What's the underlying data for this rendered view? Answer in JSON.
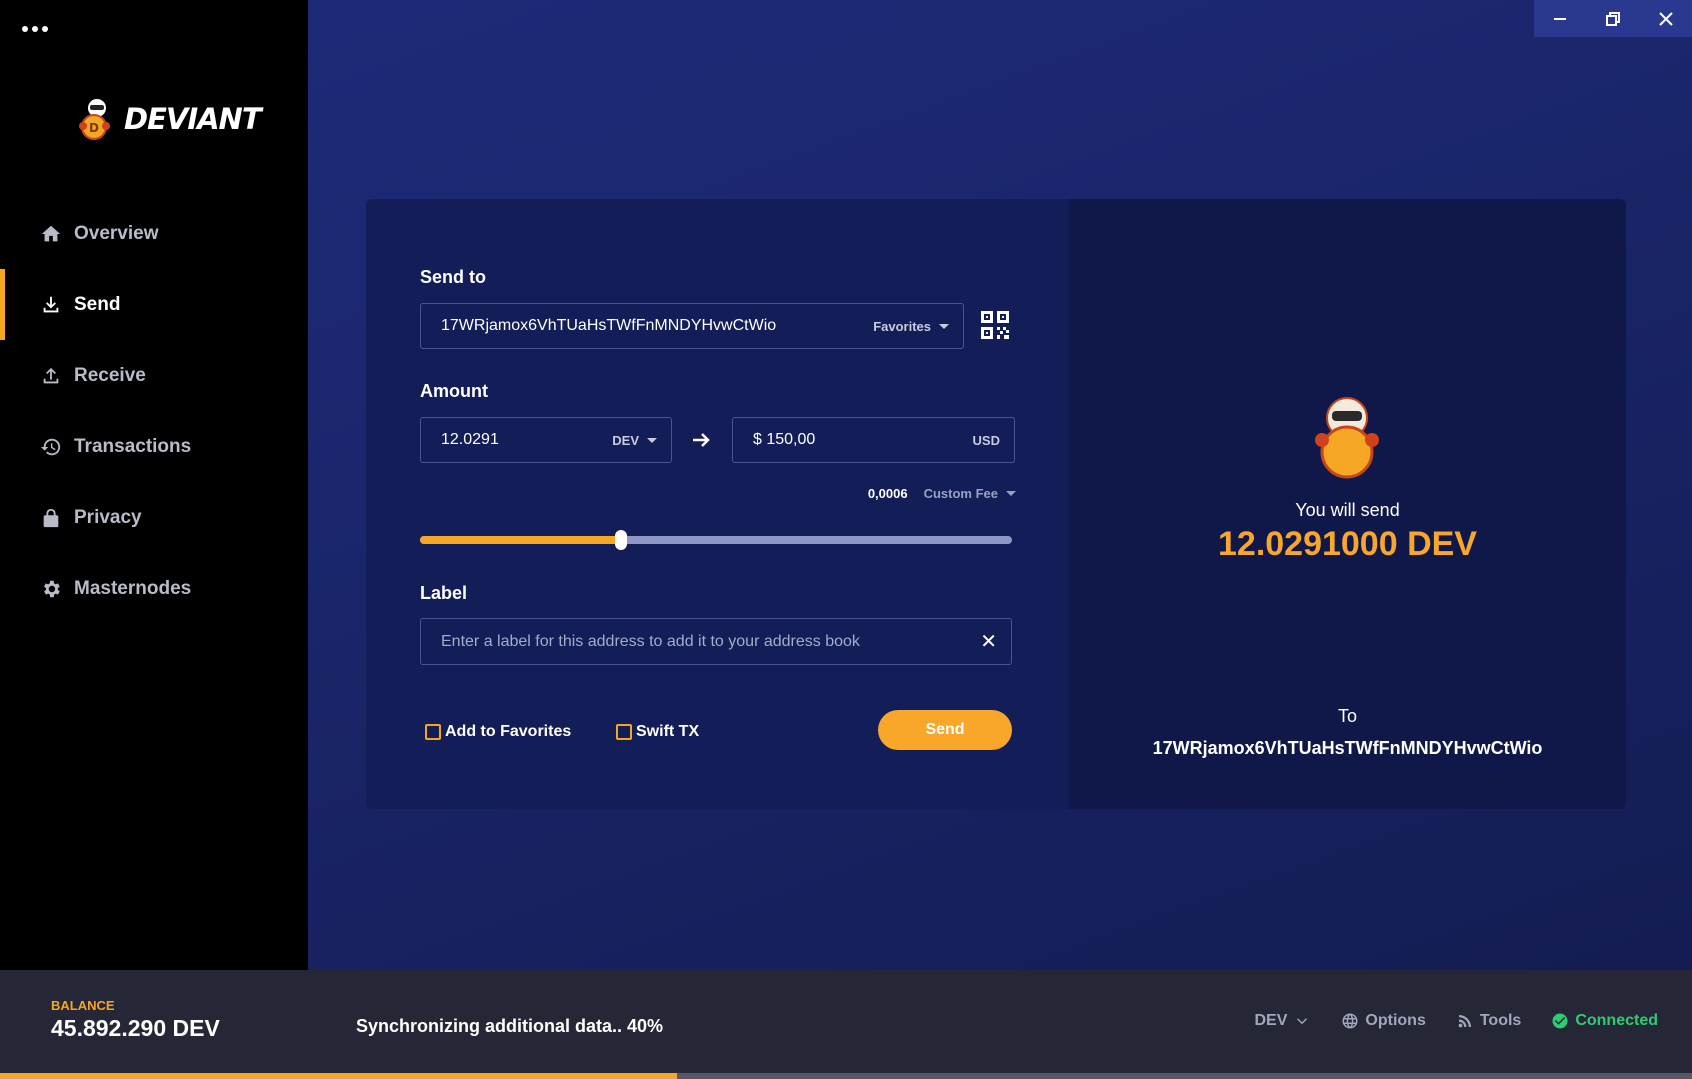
{
  "app": {
    "brand": "DEVIANT",
    "accent_color": "#f5a623"
  },
  "sidebar": {
    "items": [
      {
        "label": "Overview",
        "icon": "home-icon",
        "active": false
      },
      {
        "label": "Send",
        "icon": "download-icon",
        "active": true
      },
      {
        "label": "Receive",
        "icon": "upload-icon",
        "active": false
      },
      {
        "label": "Transactions",
        "icon": "history-icon",
        "active": false
      },
      {
        "label": "Privacy",
        "icon": "lock-icon",
        "active": false
      },
      {
        "label": "Masternodes",
        "icon": "gear-icon",
        "active": false
      }
    ]
  },
  "send_form": {
    "send_to_label": "Send to",
    "address": "17WRjamox6VhTUaHsTWfFnMNDYHvwCtWio",
    "favorites_label": "Favorites",
    "amount_label": "Amount",
    "amount_value": "12.0291",
    "amount_currency": "DEV",
    "fiat_value": "$ 150,00",
    "fiat_currency": "USD",
    "fee_value": "0,0006",
    "fee_mode": "Custom Fee",
    "fee_slider_percent": 34,
    "label_label": "Label",
    "label_placeholder": "Enter a label for this address to add it to your address book",
    "clear_symbol": "✕",
    "add_to_favorites": "Add to Favorites",
    "swift_tx": "Swift TX",
    "send_button": "Send"
  },
  "summary": {
    "you_will_send": "You will send",
    "amount": "12.0291000 DEV",
    "to_label": "To",
    "to_address": "17WRjamox6VhTUaHsTWfFnMNDYHvwCtWio"
  },
  "footer": {
    "balance_label": "BALANCE",
    "balance_value": "45.892.290 DEV",
    "sync_text": "Synchronizing additional data.. 40%",
    "sync_progress_percent": 40,
    "currency": "DEV",
    "options": "Options",
    "tools": "Tools",
    "status": "Connected",
    "status_color": "#2ecc71"
  }
}
